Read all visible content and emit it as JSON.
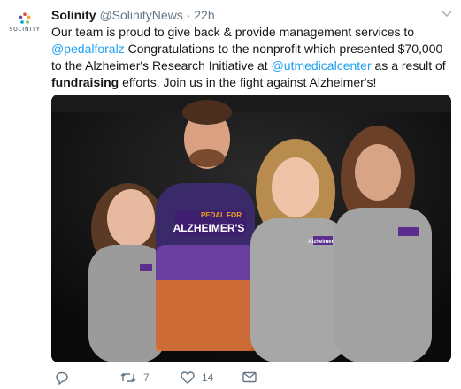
{
  "tweet": {
    "author_name": "Solinity",
    "handle": "@SolinityNews",
    "separator": "·",
    "timestamp": "22h",
    "brand_logo_text": "SOLINITY",
    "text": {
      "p1": "Our team is proud to give back & provide management services to ",
      "mention1": "@pedalforalz",
      "p2": " Congratulations to the nonprofit which presented $70,000 to the Alzheimer's Research Initiative at ",
      "mention2": "@utmedicalcenter",
      "p3": " as a result of ",
      "bold1": "fundraising",
      "p4": " efforts. Join us in the fight against Alzheimer's!"
    },
    "photo": {
      "jersey_line1": "PEDAL FOR",
      "jersey_line2": "ALZHEIMER'S",
      "shirt_logo": "Alzheimer's"
    },
    "actions": {
      "reply_icon": "reply-icon",
      "retweet_icon": "retweet-icon",
      "retweet_count": "7",
      "like_icon": "heart-icon",
      "like_count": "14",
      "dm_icon": "envelope-icon"
    },
    "colors": {
      "link": "#1da1f2",
      "muted": "#657786",
      "text": "#14171a"
    }
  }
}
